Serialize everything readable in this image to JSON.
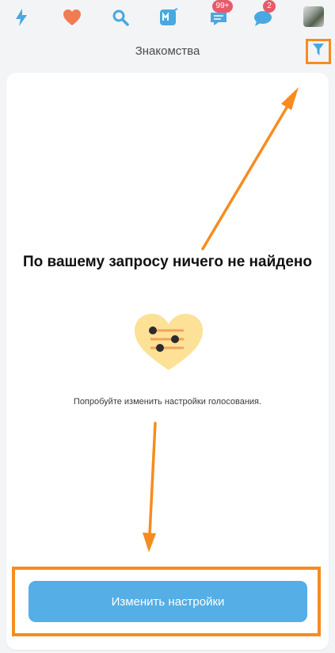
{
  "nav": {
    "messages_badge": "99+",
    "chat_badge": "2"
  },
  "header": {
    "title": "Знакомства"
  },
  "empty_state": {
    "title": "По вашему запросу ничего не найдено",
    "hint": "Попробуйте изменить настройки голосования."
  },
  "actions": {
    "change_settings_label": "Изменить настройки"
  },
  "icons": {
    "nav": [
      "lightning-icon",
      "heart-icon",
      "search-icon",
      "mamba-icon",
      "messages-icon",
      "chat-icon"
    ],
    "filter": "filter-icon",
    "illustration": "heart-settings-icon"
  },
  "colors": {
    "accent_blue": "#48a8e0",
    "heart_orange": "#f07c52",
    "badge_red": "#e95a6a",
    "annotation_orange": "#f68c1f",
    "button_blue": "#55aee5"
  }
}
